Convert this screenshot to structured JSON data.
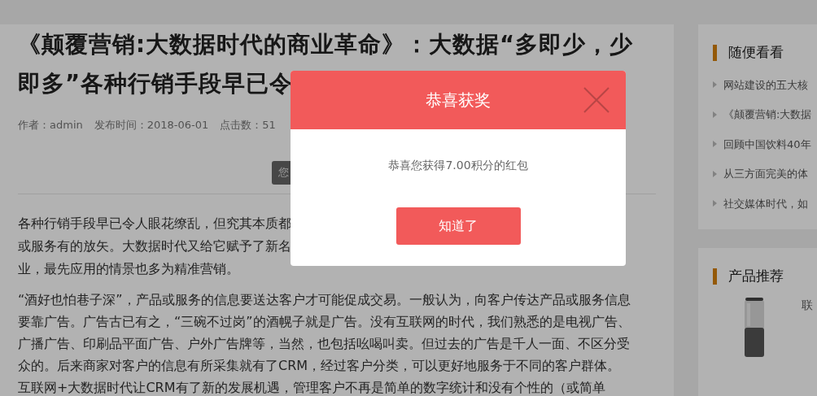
{
  "article": {
    "title_lines": [
      "《颠覆营销:大数据时代的商业革命》：大数据“多即少，少",
      "即多”各种行销手段早已令"
    ],
    "meta": [
      {
        "label": "作者：admin"
      },
      {
        "label": "发布时间：2018-06-01"
      },
      {
        "label": "点击数：51"
      }
    ],
    "action_button": "您",
    "paragraph_1_lines": [
      "各种行销手段早已令人眼花缭乱，但究其本质都",
      "或服务有的放矢。大数据时代又给它赋予了新名",
      "业，最先应用的情景也多为精准营销。"
    ],
    "paragraph_2": "“酒好也怕巷子深”，产品或服务的信息要送达客户才可能促成交易。一般认为，向客户传达产品或服务信息要靠广告。广告古已有之，“三碗不过岗”的酒幌子就是广告。没有互联网的时代，我们熟悉的是电视广告、广播广告、印刷品平面广告、户外广告牌等，当然，也包括吆喝叫卖。但过去的广告是千人一面、不区分受众的。后来商家对客户的信息有所采集就有了CRM，经过客户分类，可以更好地服务于不同的客户群体。互联网+大数据时代让CRM有了新的发展机遇，管理客户不再是简单的数字统计和没有个性的（或简单"
  },
  "sidebar": {
    "random": {
      "heading": "随便看看",
      "items": [
        "网站建设的五大核",
        "《颠覆营销:大数据",
        "回顾中国饮料40年",
        "从三方面完美的体",
        "社交媒体时代，如"
      ]
    },
    "products": {
      "heading": "产品推荐",
      "items": [
        {
          "kind": "picture",
          "name": "联"
        }
      ]
    }
  },
  "modal": {
    "title": "恭喜获奖",
    "message": "恭喜您获得7.00积分的红包",
    "button": "知道了"
  }
}
